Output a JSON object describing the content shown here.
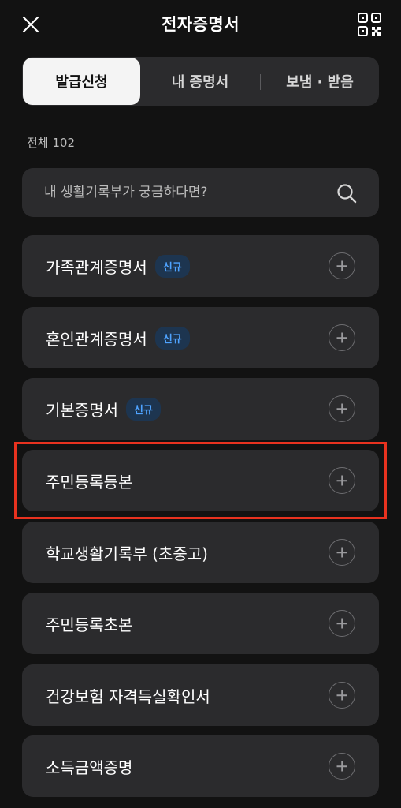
{
  "header": {
    "title": "전자증명서",
    "close_icon": "close-icon",
    "qr_icon": "qr-code-icon"
  },
  "tabs": [
    {
      "label": "발급신청",
      "active": true
    },
    {
      "label": "내 증명서",
      "active": false
    },
    {
      "label": "보냄 · 받음",
      "active": false
    }
  ],
  "count_label": "전체 102",
  "search": {
    "placeholder": "내 생활기록부가 궁금하다면?",
    "value": "",
    "icon": "search-icon"
  },
  "items": [
    {
      "label": "가족관계증명서",
      "badge": "신규"
    },
    {
      "label": "혼인관계증명서",
      "badge": "신규"
    },
    {
      "label": "기본증명서",
      "badge": "신규"
    },
    {
      "label": "주민등록등본",
      "highlighted": true
    },
    {
      "label": "학교생활기록부 (초중고)"
    },
    {
      "label": "주민등록초본"
    },
    {
      "label": "건강보험 자격득실확인서"
    },
    {
      "label": "소득금액증명"
    }
  ],
  "colors": {
    "background": "#121212",
    "card": "#2b2b2d",
    "active_tab": "#f4f4f4",
    "badge_bg": "#1d3550",
    "badge_text": "#4fa3ff",
    "highlight": "#e8321f"
  }
}
